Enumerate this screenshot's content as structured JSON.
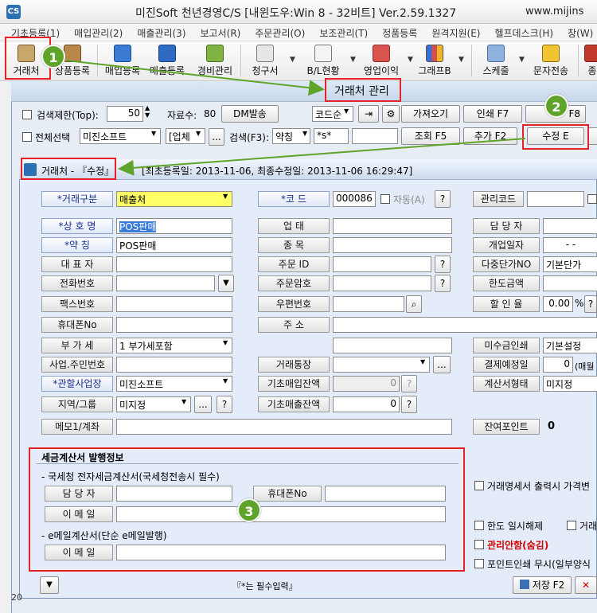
{
  "window": {
    "app_icon": "CS",
    "title": "미진Soft 천년경영C/S [내윈도우:Win 8 - 32비트] Ver.2.59.1327",
    "site": "www.mijins"
  },
  "menu": [
    "기초등록(1)",
    "매입관리(2)",
    "매출관리(3)",
    "보고서(R)",
    "주문관리(O)",
    "보조관리(T)",
    "정품등록",
    "원격지원(E)",
    "헬프데스크(H)",
    "창(W)"
  ],
  "toolbar": [
    {
      "label": "거래처",
      "icon": "address-book-icon"
    },
    {
      "label": "상품등록",
      "icon": "box-icon"
    },
    {
      "label": "매입등록",
      "icon": "cart-icon"
    },
    {
      "label": "매출등록",
      "icon": "truck-icon"
    },
    {
      "label": "경비관리",
      "icon": "coins-icon"
    },
    {
      "label": "청구서",
      "icon": "invoice-icon"
    },
    {
      "label": "B/L현황",
      "icon": "calendar-icon"
    },
    {
      "label": "영업이익",
      "icon": "pencil-chart-icon"
    },
    {
      "label": "그래프B",
      "icon": "bar-chart-icon"
    },
    {
      "label": "스케줄",
      "icon": "schedule-icon"
    },
    {
      "label": "문자전송",
      "icon": "sms-icon"
    },
    {
      "label": "종",
      "icon": "more-icon"
    }
  ],
  "badges": [
    "1",
    "2",
    "3"
  ],
  "inner": {
    "title": "거래처 관리",
    "search_limit_label": "검색제한(Top):",
    "search_limit_value": "50",
    "count_label": "자료수:",
    "count_value": "80",
    "dm_button": "DM발송",
    "sort_value": "코드순",
    "fetch_button": "가져오기",
    "print_button": "인쇄 F7",
    "excel_button": "F8",
    "select_all_label": "전체선택",
    "company_value": "미진소프트",
    "type_value": "[업체",
    "ellipsis": "...",
    "search_label": "검색(F3):",
    "search_field_value": "약칭",
    "search_mode_value": "*s*",
    "query_button": "조회 F5",
    "add_button": "추가 F2",
    "edit_button": "수정 E"
  },
  "form": {
    "title": "거래처 - 『수정』",
    "meta": "[최초등록일: 2013-11-06, 최종수정일: 2013-11-06 16:29:47]",
    "labels": {
      "trade_type": "*거래구분",
      "code": "*코 드",
      "auto": "자동(A)",
      "admin_code": "관리코드",
      "company_name": "*상 호 명",
      "business_type": "업 태",
      "manager": "담 당 자",
      "short_name": "*약 칭",
      "category": "종 목",
      "open_date": "개업일자",
      "representative": "대 표 자",
      "order_id": "주문 ID",
      "multi_price": "다중단가NO",
      "phone": "전화번호",
      "order_pw": "주문암호",
      "credit_limit": "한도금액",
      "fax": "팩스번호",
      "zipcode": "우편번호",
      "discount": "할 인 율",
      "mobile": "휴대폰No",
      "address": "주 소",
      "vat": "부 가 세",
      "unpaid_print": "미수금인쇄",
      "biz_number": "사업.주민번호",
      "trade_bank": "거래통장",
      "settlement_day": "결제예정일",
      "biz_site": "*관할사업장",
      "base_purchase": "기초매입잔액",
      "invoice_type": "계산서형태",
      "region_group": "지역/그룹",
      "base_sales": "기초매출잔액",
      "memo": "메모1/계좌",
      "remaining_points": "잔여포인트"
    },
    "values": {
      "trade_type": "매출처",
      "code": "000086",
      "company_name": "POS판매",
      "short_name": "POS판매",
      "multi_price": "기본단가",
      "discount": "0.00",
      "percent": "%",
      "vat": "1 부가세포함",
      "unpaid_print": "기본설정",
      "settlement_day": "0",
      "settlement_unit": "(매월",
      "biz_site": "미진소프트",
      "base_purchase": "0",
      "invoice_type": "미지정",
      "region_group": "미지정",
      "base_sales": "0",
      "remaining_points": "0",
      "open_date": "-  -"
    },
    "help": "?",
    "tax": {
      "title": "세금계산서 발행정보",
      "subtitle1": "- 국세청 전자세금계산서(국세청전송시 필수)",
      "manager": "담 당 자",
      "mobile": "휴대폰No",
      "email": "이 메 일",
      "subtitle2": "- e메일계산서(단순 e메일발행)",
      "email2": "이 메 일"
    },
    "options": {
      "print_price": "거래명세서 출력시 가격변",
      "limit_release": "한도 일시해제",
      "trade_stop": "거래",
      "manage_secret": "관리안함(숨김)",
      "point_ignore": "포인트인쇄 무시(일부양식"
    },
    "required_note": "『*는 필수입력』",
    "save_button": "저장 F2"
  },
  "colors": {
    "highlight": "#ffff66",
    "red_frame": "#e8202a",
    "badge": "#5ea32a",
    "arrow": "#5ea32a"
  }
}
